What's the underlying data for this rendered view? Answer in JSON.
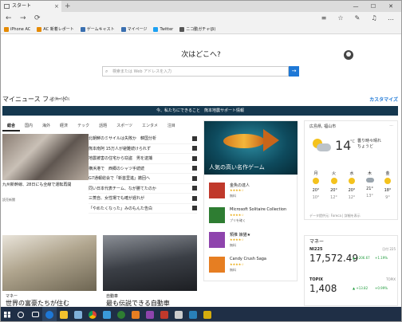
{
  "browser": {
    "tab_title": "スタート",
    "new_tab": "+",
    "tab_close": "×",
    "window_buttons": [
      "—",
      "☐",
      "✕"
    ]
  },
  "nav": {
    "back": "←",
    "forward": "→",
    "refresh": "⟳",
    "tools": [
      "≡",
      "☆",
      "✎",
      "♫",
      "…"
    ]
  },
  "favorites": [
    {
      "label": "iPhone AC",
      "color": "#e58a00"
    },
    {
      "label": "AC 新着レポート",
      "color": "#e58a00"
    },
    {
      "label": "ゲームキャスト",
      "color": "#3a6fb0"
    },
    {
      "label": "マイページ",
      "color": "#3a6fb0"
    },
    {
      "label": "Twitter",
      "color": "#1da1f2"
    },
    {
      "label": "ニコ動ガチャ(β)",
      "color": "#555555"
    }
  ],
  "start": {
    "greeting": "次はどこへ?",
    "search_placeholder": "検索または Web アドレスを入力",
    "search_button": "→"
  },
  "feed": {
    "title": "マイニュース フィード",
    "subtitle": "提供: MSN",
    "customize": "カスタマイズ",
    "banner": "今、私たちにできること　熊本地震サポート情報"
  },
  "news": {
    "tabs": [
      "総合",
      "国内",
      "海外",
      "経済",
      "テック",
      "話題",
      "スポーツ",
      "エンタメ",
      "注目"
    ],
    "active_tab": "総合",
    "lead_caption": "九州新幹線、28日にも全線で運転再開",
    "lead_source": "読売新聞",
    "headlines": [
      "北朝鮮のミサイルは失敗か　韓国分析",
      "熊本南阿 15万人が避難続けられず",
      "地震被害の住宅から窃盗　男を逮捕",
      "横浜港で　西郷のシャツ手続続",
      "G7通報総会で「新首里進」撤回へ",
      "同い日本代表チーム、なが勝てたのか",
      "三菱自、女性場でも確が遅れが",
      "「やめたくなった」みのもんた告白"
    ]
  },
  "games": {
    "hero_title": "人気の高い名作ゲーム",
    "items": [
      {
        "name": "金魚の達人",
        "stars": "★★★★☆",
        "price": "無料",
        "color": "#c0392b"
      },
      {
        "name": "Microsoft Solitaire Collection",
        "stars": "★★★★☆",
        "price": "プリを確く",
        "color": "#2e7d32"
      },
      {
        "name": "類推 娘猫★",
        "stars": "★★★★☆",
        "price": "無料",
        "color": "#8e44ad"
      },
      {
        "name": "Candy Crush Saga",
        "stars": "★★★★☆",
        "price": "無料",
        "color": "#e67e22"
      }
    ]
  },
  "weather": {
    "location": "広島県, 福山市",
    "menu": "···",
    "temp": "14",
    "unit": "°C",
    "desc": "曇り時々晴れ",
    "desc2": "ちょうど",
    "days": [
      {
        "day": "月",
        "hi": "20°",
        "lo": "10°",
        "icon": "sun"
      },
      {
        "day": "火",
        "hi": "20°",
        "lo": "12°",
        "icon": "sun"
      },
      {
        "day": "水",
        "hi": "20°",
        "lo": "12°",
        "icon": "sun"
      },
      {
        "day": "木",
        "hi": "21°",
        "lo": "13°",
        "icon": "cloud"
      },
      {
        "day": "金",
        "hi": "18°",
        "lo": "9°",
        "icon": "sun"
      }
    ],
    "source": "データ提供元: Foreca | 詳細を表示"
  },
  "markets": {
    "title": "マネー",
    "rows": [
      {
        "name": "NI225",
        "time": "日付 225",
        "value": "17,572.49",
        "change": "▲ +206.67",
        "pct": "+1.19%"
      },
      {
        "name": "TOPIX",
        "time": "TOPIX",
        "value": "1,408",
        "change": "▲ +13.82",
        "pct": "+0.99%"
      }
    ]
  },
  "articles": [
    {
      "category": "マネー",
      "title": "世界の富豪たちが住む"
    },
    {
      "category": "自動車",
      "title": "最も伝説できる自動車"
    }
  ],
  "taskbar": {
    "apps": [
      {
        "name": "search",
        "color": "#ffffff"
      },
      {
        "name": "task-view",
        "color": "#ffffff"
      },
      {
        "name": "edge",
        "color": "#1e78d6"
      },
      {
        "name": "explorer",
        "color": "#f2c12e"
      },
      {
        "name": "store",
        "color": "#7fb0d8"
      },
      {
        "name": "chrome",
        "color": "#db4437"
      },
      {
        "name": "media",
        "color": "#3a9ad9"
      },
      {
        "name": "xbox",
        "color": "#2e7d32"
      },
      {
        "name": "app-orange",
        "color": "#e67e22"
      },
      {
        "name": "photos",
        "color": "#8e44ad"
      },
      {
        "name": "filezilla",
        "color": "#c0392b"
      },
      {
        "name": "app-gray",
        "color": "#cccccc"
      },
      {
        "name": "app-blue",
        "color": "#2980b9"
      },
      {
        "name": "app-yellow",
        "color": "#d4ac0d"
      }
    ]
  }
}
